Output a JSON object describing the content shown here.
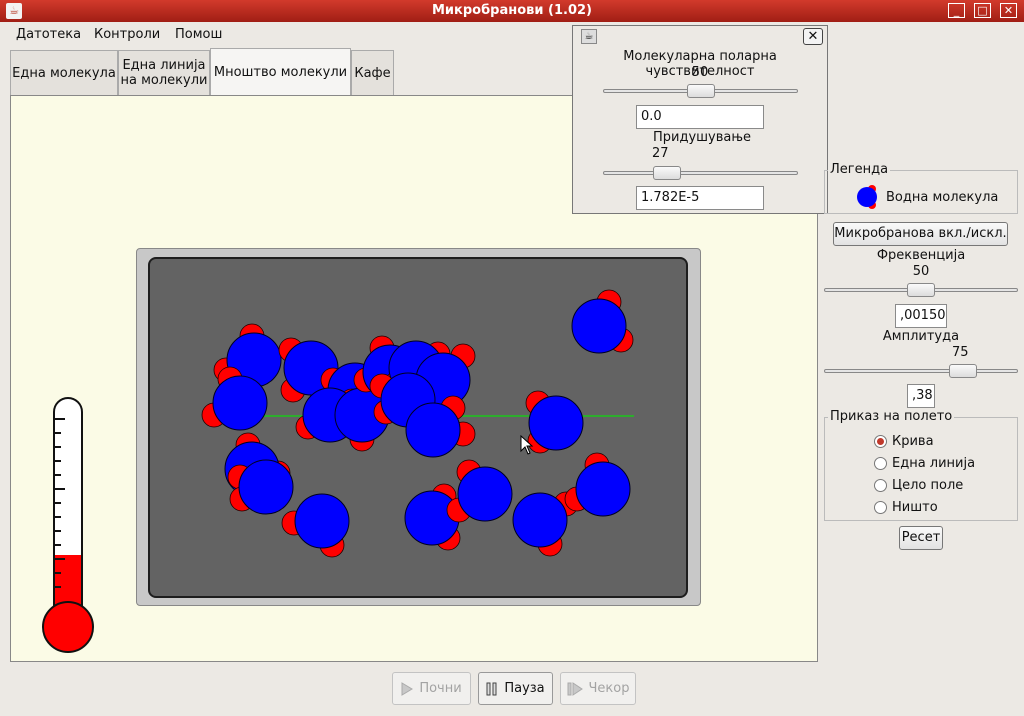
{
  "window": {
    "title": "Микробранови (1.02)",
    "minimize": "_",
    "maximize": "□",
    "close": "✕"
  },
  "menu": [
    "Датотека",
    "Контроли",
    "Помош"
  ],
  "tabs": [
    {
      "label": "Една молекула"
    },
    {
      "label_line1": "Една линија",
      "label_line2": "на молекули"
    },
    {
      "label": "Мноштво молекули"
    },
    {
      "label": "Кафе"
    }
  ],
  "popup": {
    "title_icon": "java-cup-icon",
    "close": "✕",
    "polarity_label": "Молекуларна поларна чувствителност",
    "polarity_value": "50",
    "polarity_field": "0.0",
    "polarity_slider": 0.5,
    "damping_label": "Придушување",
    "damping_value": "27",
    "damping_field": "1.782E-5",
    "damping_slider": 0.3
  },
  "legend": {
    "title": "Легенда",
    "item": "Водна молекула"
  },
  "controls": {
    "toggle_button": "Микробранова вкл./искл.",
    "frequency_label": "Фреквенција",
    "frequency_value": "50",
    "frequency_slider": 0.5,
    "frequency_field": ",00150",
    "amplitude_label": "Амплитуда",
    "amplitude_value": "75",
    "amplitude_slider": 0.75,
    "amplitude_field": ",38"
  },
  "field_display": {
    "title": "Приказ на полето",
    "options": [
      "Крива",
      "Една линија",
      "Цело поле",
      "Ништо"
    ],
    "selected": 0
  },
  "reset_button": "Ресет",
  "thermometer_level": 0.28,
  "playback": {
    "start": "Почни",
    "pause": "Пауза",
    "step": "Чекор"
  },
  "colors": {
    "molecule": "#0000ff",
    "hydrogen": "#ff0000",
    "field": "#2dad2d",
    "title_bar": "#b8281c"
  }
}
